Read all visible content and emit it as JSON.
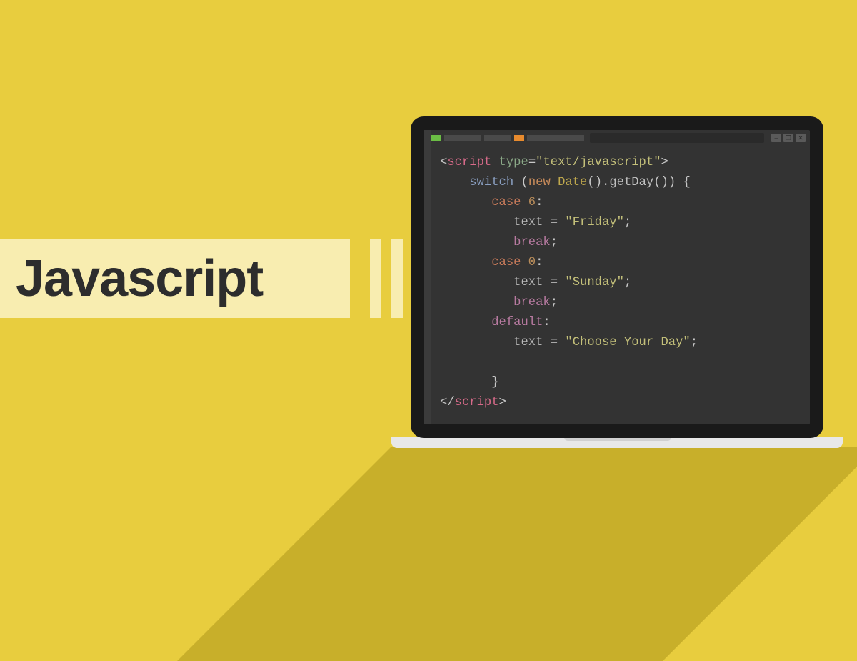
{
  "title": "Javascript",
  "colors": {
    "background": "#e8cd3e",
    "banner": "#f8edb0",
    "shadow": "#c8af2a",
    "editor_bg": "#333333",
    "frame": "#1a1a1a"
  },
  "window_controls": {
    "minimize": "–",
    "maximize": "❐",
    "close": "✕"
  },
  "code": {
    "open_bracket": "<",
    "close_bracket": ">",
    "slash": "/",
    "tag_script": "script",
    "attr_type": "type",
    "eq": "=",
    "quote": "\"",
    "val_type": "text/javascript",
    "kw_switch": "switch",
    "paren_o": "(",
    "paren_c": ")",
    "kw_new": "new",
    "cls_date": "Date",
    "dot": ".",
    "meth_getday": "getDay",
    "brace_o": "{",
    "brace_c": "}",
    "kw_case": "case",
    "colon": ":",
    "semi": ";",
    "num_6": "6",
    "num_0": "0",
    "ident_text": "text",
    "op_assign": " = ",
    "str_friday": "Friday",
    "str_sunday": "Sunday",
    "str_choose": "Choose Your Day",
    "kw_break": "break",
    "kw_default": "default"
  }
}
